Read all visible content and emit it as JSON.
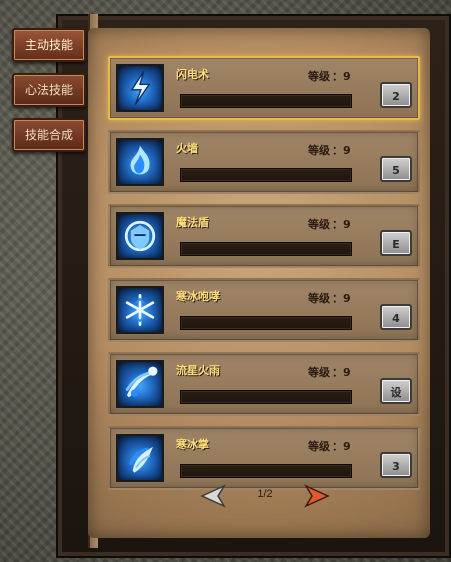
{
  "tabs": [
    {
      "label": "主动技能",
      "active": true
    },
    {
      "label": "心法技能",
      "active": false
    },
    {
      "label": "技能合成",
      "active": false
    }
  ],
  "skills": [
    {
      "name": "闪电术",
      "level_label": "等级",
      "level": "：9",
      "hotkey": "2",
      "icon": "lightning-icon",
      "selected": true,
      "exp": 0
    },
    {
      "name": "火墙",
      "level_label": "等级",
      "level": "：9",
      "hotkey": "5",
      "icon": "flame-icon",
      "selected": false,
      "exp": 0
    },
    {
      "name": "魔法盾",
      "level_label": "等级",
      "level": "：9",
      "hotkey": "E",
      "icon": "shield-icon",
      "selected": false,
      "exp": 0
    },
    {
      "name": "寒冰咆哮",
      "level_label": "等级",
      "level": "：9",
      "hotkey": "4",
      "icon": "snowflake-icon",
      "selected": false,
      "exp": 0
    },
    {
      "name": "流星火雨",
      "level_label": "等级",
      "level": "：9",
      "hotkey": "设",
      "icon": "meteor-icon",
      "selected": false,
      "exp": 0
    },
    {
      "name": "寒冰掌",
      "level_label": "等级",
      "level": "：9",
      "hotkey": "3",
      "icon": "ice-palm-icon",
      "selected": false,
      "exp": 0
    }
  ],
  "pager": {
    "text": "1/2"
  }
}
